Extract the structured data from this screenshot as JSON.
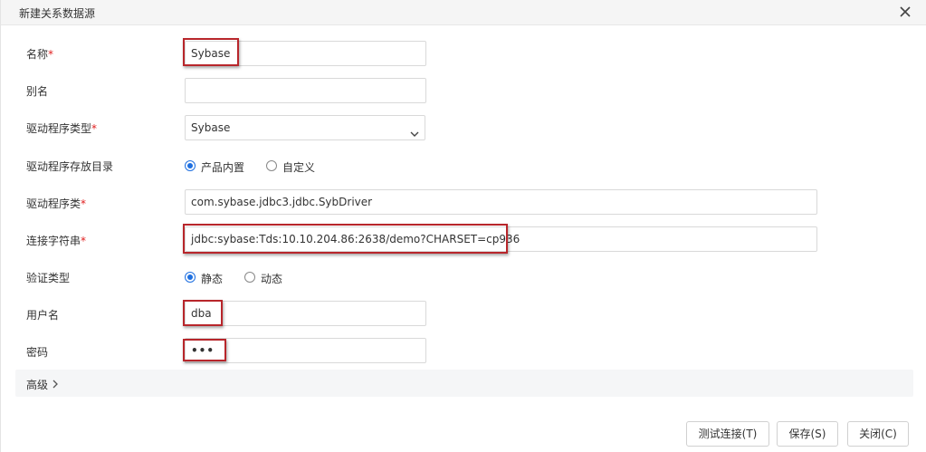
{
  "dialog": {
    "title": "新建关系数据源",
    "close_icon": "close-icon"
  },
  "form": {
    "required_mark": "*",
    "name": {
      "label": "名称",
      "required": true,
      "value": "Sybase"
    },
    "alias": {
      "label": "别名",
      "required": false,
      "value": ""
    },
    "driver_type": {
      "label": "驱动程序类型",
      "required": true,
      "selected": "Sybase",
      "icon": "chevron-down-icon"
    },
    "driver_dir": {
      "label": "驱动程序存放目录",
      "options": [
        {
          "label": "产品内置",
          "checked": true
        },
        {
          "label": "自定义",
          "checked": false
        }
      ]
    },
    "driver_class": {
      "label": "驱动程序类",
      "required": true,
      "value": "com.sybase.jdbc3.jdbc.SybDriver"
    },
    "connection_string": {
      "label": "连接字符串",
      "required": true,
      "value": "jdbc:sybase:Tds:10.10.204.86:2638/demo?CHARSET=cp936"
    },
    "auth_type": {
      "label": "验证类型",
      "options": [
        {
          "label": "静态",
          "checked": true
        },
        {
          "label": "动态",
          "checked": false
        }
      ]
    },
    "username": {
      "label": "用户名",
      "value": "dba"
    },
    "password": {
      "label": "密码",
      "value": "•••"
    }
  },
  "advanced": {
    "label": "高级",
    "icon": "chevron-right-icon"
  },
  "buttons": {
    "test": "测试连接(T)",
    "save": "保存(S)",
    "close": "关闭(C)"
  },
  "colors": {
    "accent": "#1e6fe0",
    "required": "#e02020",
    "highlight_border": "#b8262b"
  }
}
